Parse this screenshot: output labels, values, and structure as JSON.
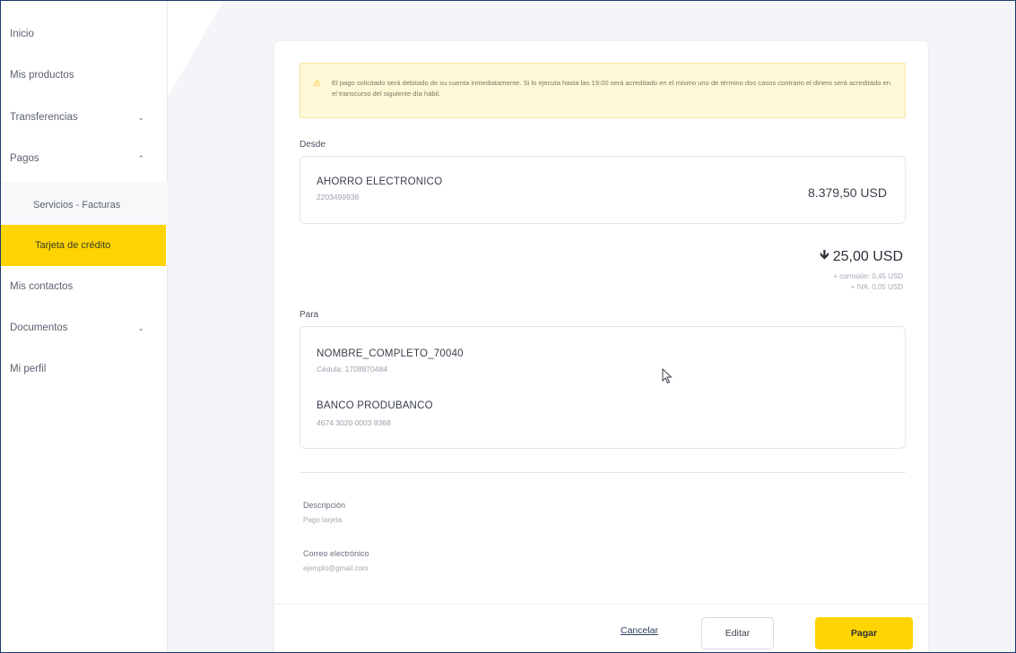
{
  "sidebar": {
    "items": [
      {
        "label": "Inicio"
      },
      {
        "label": "Mis productos"
      },
      {
        "label": "Transferencias"
      },
      {
        "label": "Pagos"
      },
      {
        "label": "Mis contactos"
      },
      {
        "label": "Documentos"
      },
      {
        "label": "Mi perfil"
      }
    ],
    "sub_items": [
      {
        "label": "Servicios - Facturas"
      },
      {
        "label": "Tarjeta de crédito"
      }
    ],
    "chevrons": {
      "down": "⌄",
      "up": "⌃"
    }
  },
  "alert": {
    "icon": "⚠",
    "text": "El pago solicitado será debitado de su cuenta inmediatamente. Si lo ejecuta hasta las 19:00 será acreditado en el mismo uno de término dos casos contrario el dinero será acreditado en el transcurso del siguiente día hábil."
  },
  "from": {
    "label": "Desde",
    "account_name": "AHORRO ELECTRONICO",
    "account_number": "2203499938",
    "balance": "8.379,50 USD"
  },
  "transfer": {
    "arrow": "🡻",
    "amount": "25,00 USD",
    "commission": "+ comisión: 0,45 USD",
    "iva": "+ IVA: 0,05 USD"
  },
  "to": {
    "label": "Para",
    "name": "NOMBRE_COMPLETO_70040",
    "id_doc": "Cédula: 1708870484",
    "bank": "BANCO PRODUBANCO",
    "card_number": "4674 3020 0003 8368"
  },
  "details": {
    "description_label": "Descripción",
    "description_value": "Pago tarjeta",
    "email_label": "Correo electrónico",
    "email_value": "ejemplo@gmail.com"
  },
  "actions": {
    "cancel": "Cancelar",
    "edit": "Editar",
    "pay": "Pagar"
  },
  "colors": {
    "accent": "#ffd400",
    "alert_bg": "#fff8d7"
  }
}
